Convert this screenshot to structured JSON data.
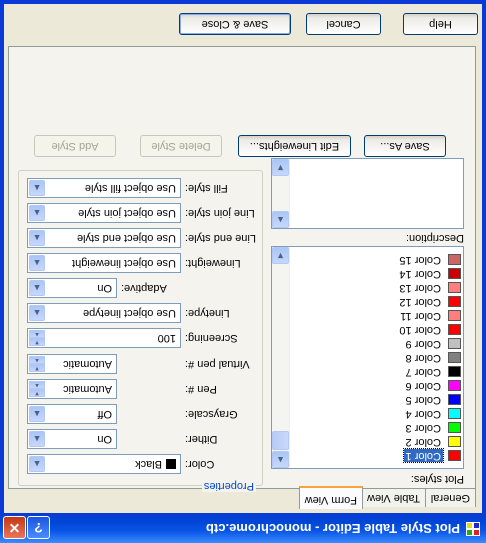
{
  "window": {
    "title": "Plot Style Table Editor - monochrome.ctb",
    "help_glyph": "?",
    "close_glyph": "✕"
  },
  "tabs": [
    {
      "label": "General"
    },
    {
      "label": "Table View"
    },
    {
      "label": "Form View"
    }
  ],
  "plot_styles": {
    "label": "Plot styles:",
    "items": [
      {
        "label": "Color 1",
        "color": "#ff0000",
        "selected": true
      },
      {
        "label": "Color 2",
        "color": "#ffff00"
      },
      {
        "label": "Color 3",
        "color": "#00ff00"
      },
      {
        "label": "Color 4",
        "color": "#00ffff"
      },
      {
        "label": "Color 5",
        "color": "#0000ff"
      },
      {
        "label": "Color 6",
        "color": "#ff00ff"
      },
      {
        "label": "Color 7",
        "color": "#000000"
      },
      {
        "label": "Color 8",
        "color": "#808080"
      },
      {
        "label": "Color 9",
        "color": "#c0c0c0"
      },
      {
        "label": "Color 10",
        "color": "#ff0000"
      },
      {
        "label": "Color 11",
        "color": "#ff7f7f"
      },
      {
        "label": "Color 12",
        "color": "#ff0000"
      },
      {
        "label": "Color 13",
        "color": "#ff7f7f"
      },
      {
        "label": "Color 14",
        "color": "#cc0000"
      },
      {
        "label": "Color 15",
        "color": "#cc6666"
      }
    ]
  },
  "description": {
    "label": "Description:",
    "value": ""
  },
  "properties": {
    "title": "Properties",
    "color": {
      "label": "Color:",
      "value": "Black",
      "chip": "#000000"
    },
    "dither": {
      "label": "Dither:",
      "value": "On"
    },
    "grayscale": {
      "label": "Grayscale:",
      "value": "Off"
    },
    "pen": {
      "label": "Pen #:",
      "value": "Automatic"
    },
    "virtual_pen": {
      "label": "Virtual pen #:",
      "value": "Automatic"
    },
    "screening": {
      "label": "Screening:",
      "value": "100"
    },
    "linetype": {
      "label": "Linetype:",
      "value": "Use object linetype"
    },
    "adaptive": {
      "label": "Adaptive:",
      "value": "On"
    },
    "lineweight": {
      "label": "Lineweight:",
      "value": "Use object lineweight"
    },
    "line_end_style": {
      "label": "Line end style:",
      "value": "Use object end style"
    },
    "line_join_style": {
      "label": "Line join style:",
      "value": "Use object join style"
    },
    "fill_style": {
      "label": "Fill style:",
      "value": "Use object fill style"
    }
  },
  "buttons": {
    "add_style": "Add Style",
    "delete_style": "Delete Style",
    "edit_lineweights": "Edit Lineweights...",
    "save_as": "Save As...",
    "save_close": "Save & Close",
    "cancel": "Cancel",
    "help": "Help"
  }
}
